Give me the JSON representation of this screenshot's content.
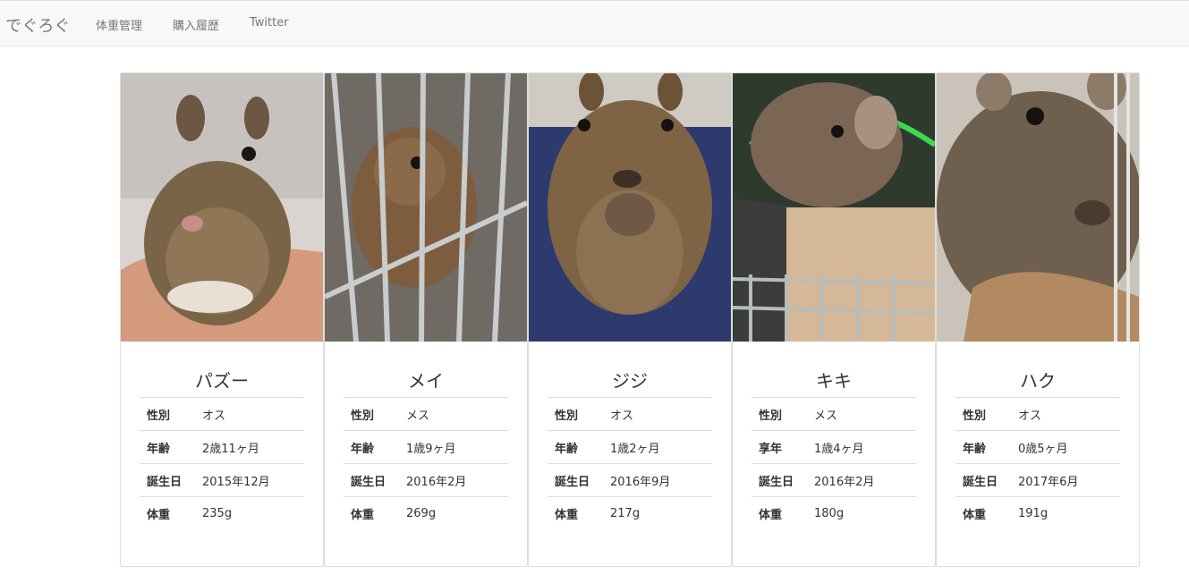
{
  "navbar": {
    "brand": "でぐろぐ",
    "links": [
      {
        "label": "体重管理"
      },
      {
        "label": "購入履歴"
      },
      {
        "label": "Twitter"
      }
    ]
  },
  "cards": [
    {
      "name": "パズー",
      "rows": [
        {
          "key": "性別",
          "value": "オス"
        },
        {
          "key": "年齢",
          "value": "2歳11ヶ月"
        },
        {
          "key": "誕生日",
          "value": "2015年12月"
        },
        {
          "key": "体重",
          "value": "235g"
        }
      ]
    },
    {
      "name": "メイ",
      "rows": [
        {
          "key": "性別",
          "value": "メス"
        },
        {
          "key": "年齢",
          "value": "1歳9ヶ月"
        },
        {
          "key": "誕生日",
          "value": "2016年2月"
        },
        {
          "key": "体重",
          "value": "269g"
        }
      ]
    },
    {
      "name": "ジジ",
      "rows": [
        {
          "key": "性別",
          "value": "オス"
        },
        {
          "key": "年齢",
          "value": "1歳2ヶ月"
        },
        {
          "key": "誕生日",
          "value": "2016年9月"
        },
        {
          "key": "体重",
          "value": "217g"
        }
      ]
    },
    {
      "name": "キキ",
      "rows": [
        {
          "key": "性別",
          "value": "メス"
        },
        {
          "key": "享年",
          "value": "1歳4ヶ月"
        },
        {
          "key": "誕生日",
          "value": "2016年2月"
        },
        {
          "key": "体重",
          "value": "180g"
        }
      ]
    },
    {
      "name": "ハク",
      "rows": [
        {
          "key": "性別",
          "value": "オス"
        },
        {
          "key": "年齢",
          "value": "0歳5ヶ月"
        },
        {
          "key": "誕生日",
          "value": "2017年6月"
        },
        {
          "key": "体重",
          "value": "191g"
        }
      ]
    }
  ]
}
